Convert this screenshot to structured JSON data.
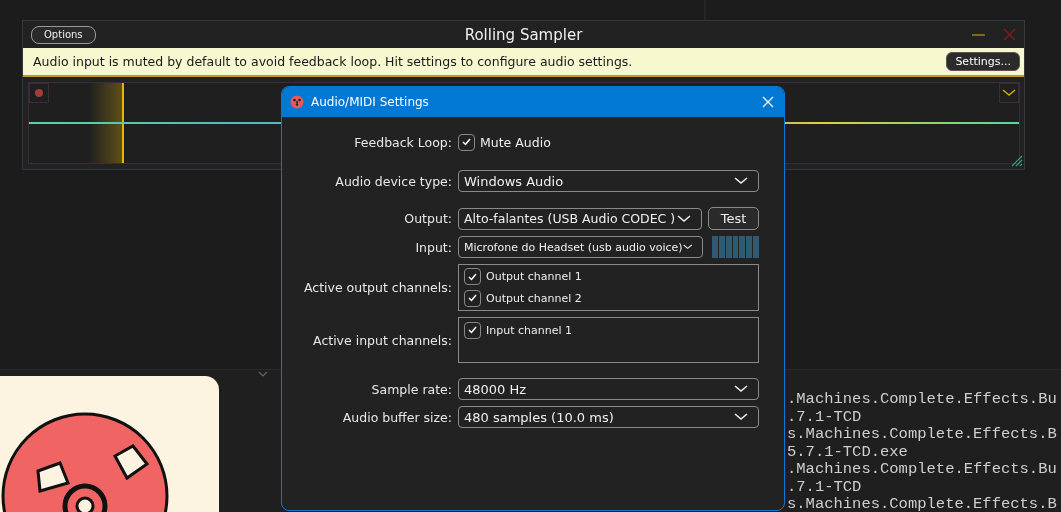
{
  "terminal": {
    "lines": [
      ".Machines.Complete.Effects.Bu",
      ".7.1-TCD",
      "s.Machines.Complete.Effects.B",
      "5.7.1-TCD.exe",
      ".Machines.Complete.Effects.Bu",
      ".7.1-TCD",
      "s.Machines.Complete.Effects.B"
    ]
  },
  "sampler": {
    "title": "Rolling Sampler",
    "options_button": "Options",
    "banner": {
      "message": "Audio input is muted by default to avoid feedback loop. Hit settings to configure audio settings.",
      "settings_button": "Settings..."
    }
  },
  "dialog": {
    "title": "Audio/MIDI Settings",
    "sections": [
      [
        {
          "kind": "checkbox",
          "label": "Feedback Loop:",
          "option": {
            "label": "Mute Audio",
            "checked": true
          }
        }
      ],
      [
        {
          "kind": "dropdown",
          "label": "Audio device type:",
          "value": "Windows Audio"
        }
      ],
      [
        {
          "kind": "dropdown_button",
          "label": "Output:",
          "value": "Alto-falantes (USB Audio CODEC )",
          "button": "Test"
        },
        {
          "kind": "dropdown_meter",
          "label": "Input:",
          "value": "Microfone do Headset (usb audio voice)"
        },
        {
          "kind": "channel_list",
          "label": "Active output channels:",
          "channels": [
            {
              "label": "Output channel 1",
              "checked": true
            },
            {
              "label": "Output channel 2",
              "checked": true
            }
          ]
        },
        {
          "kind": "channel_list",
          "label": "Active input channels:",
          "channels": [
            {
              "label": "Input channel 1",
              "checked": true
            }
          ]
        }
      ],
      [
        {
          "kind": "dropdown",
          "label": "Sample rate:",
          "value": "48000 Hz"
        },
        {
          "kind": "dropdown",
          "label": "Audio buffer size:",
          "value": "480 samples (10.0 ms)"
        }
      ]
    ]
  }
}
